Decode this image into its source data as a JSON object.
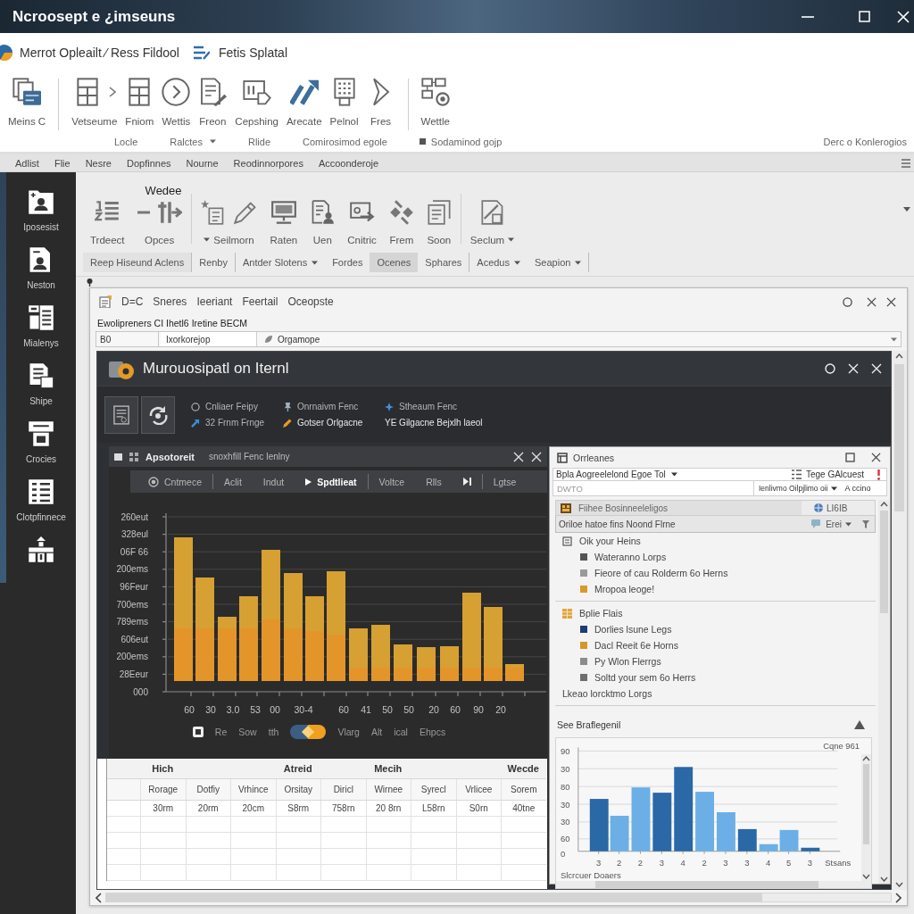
{
  "window": {
    "title": "Ncroosept e ¿imseuns"
  },
  "app_bar": {
    "breadcrumb": "Merrot Opleailt ⁄ Ress Fildool",
    "document": "Fetis Splatal"
  },
  "ribbon": {
    "sections": [
      [
        {
          "label": "Meins C"
        }
      ],
      [
        {
          "label": "Vetseume"
        },
        {
          "label": "Fniom"
        },
        {
          "label": "Wettis"
        },
        {
          "label": "Freon"
        },
        {
          "label": "Cepshing"
        },
        {
          "label": "Arecate"
        },
        {
          "label": "Pelnol"
        },
        {
          "label": "Fres"
        }
      ],
      [
        {
          "label": "Wettle"
        }
      ]
    ],
    "groups": [
      {
        "label": "Locle",
        "kind": "plain"
      },
      {
        "label": "Ralctes",
        "kind": "menu"
      },
      {
        "label": "Rlide",
        "kind": "plain"
      },
      {
        "label": "Comirosimod egole",
        "kind": "plain"
      },
      {
        "label": "Sodaminod gojp",
        "kind": "marked"
      }
    ],
    "right_label": "Derc o Konlerogios"
  },
  "menu_bar": [
    "Adlist",
    "Flie",
    "Nesre",
    "Dopfinnes",
    "Nourne",
    "Reodinnorpores",
    "Accoonderoje"
  ],
  "sidebar": {
    "items": [
      {
        "label": "Iposesist"
      },
      {
        "label": "Neston"
      },
      {
        "label": "Mialenys"
      },
      {
        "label": "Shipe"
      },
      {
        "label": "Crocies"
      },
      {
        "label": "Clotpfinnece"
      }
    ]
  },
  "ribbon_2": {
    "group_title": "Wedee",
    "sections": [
      [
        {
          "label": "Trdeect",
          "kind": "plain"
        },
        {
          "label": "Opces",
          "kind": "plain"
        }
      ],
      [
        {
          "label": "Seilmorn",
          "kind": "lead_menu"
        },
        {
          "label": "Raten",
          "kind": "plain"
        },
        {
          "label": "Uen",
          "kind": "plain"
        },
        {
          "label": "Cnitric",
          "kind": "plain"
        },
        {
          "label": "Frem",
          "kind": "plain"
        },
        {
          "label": "Soon",
          "kind": "plain"
        }
      ],
      [
        {
          "label": "Seclum",
          "kind": "menu"
        }
      ]
    ],
    "commands": [
      {
        "label": "Reep Hiseund Aclens",
        "kind": "label",
        "selected": false,
        "divider": true
      },
      {
        "label": "Renby",
        "kind": "plain",
        "selected": false,
        "divider": true
      },
      {
        "label": "Antder Slotens",
        "kind": "menu",
        "selected": false,
        "divider": false
      },
      {
        "label": "Fordes",
        "kind": "plain",
        "selected": false,
        "divider": false
      },
      {
        "label": "Ocenes",
        "kind": "plain",
        "selected": true,
        "divider": false
      },
      {
        "label": "Sphares",
        "kind": "plain",
        "selected": false,
        "divider": true
      },
      {
        "label": "Acedus",
        "kind": "menu",
        "selected": false,
        "divider": false
      },
      {
        "label": "Seapion",
        "kind": "menu",
        "selected": false,
        "divider": true
      }
    ]
  },
  "document_window": {
    "menu": [
      "D=C",
      "Sneres",
      "Ieeriant",
      "Feertail",
      "Oceopste"
    ],
    "info": "Ewolipreners CI Ihetl6 Iretine BECM",
    "fields": [
      {
        "value": "B0"
      },
      {
        "value": "Ixorkorejop"
      },
      {
        "value": "Orgamope"
      }
    ]
  },
  "dark_window": {
    "title": "Murouosipatl on Iternl",
    "options": [
      {
        "label": "Cnliaer Feipy"
      },
      {
        "label": "Onrnaivm Fenc"
      },
      {
        "label": "Stheaum Fenc"
      },
      {
        "label": "32 Frnm Frnge"
      },
      {
        "label": "Gotser Orlgacne"
      },
      {
        "label": "YE Gilgacne Bejxlh laeol"
      }
    ]
  },
  "chart_panel": {
    "title": "Apsotoreit",
    "subtitle": "snoxhfill Fenc Ienlny",
    "tabs": [
      {
        "label": "Cntmece",
        "selected": false,
        "divider": true
      },
      {
        "label": "Aclit",
        "selected": false,
        "divider": false
      },
      {
        "label": "Indut",
        "selected": false,
        "divider": false
      },
      {
        "label": "Spdtlieat",
        "selected": true,
        "divider": true
      },
      {
        "label": "Voltce",
        "selected": false,
        "divider": false
      },
      {
        "label": "Rlls",
        "selected": false,
        "divider": false
      },
      {
        "label": "Lgtse",
        "selected": false,
        "divider": false
      }
    ],
    "y_labels": [
      "260eut",
      "328eul",
      "06F 66",
      "200ems",
      "96Feur",
      "700ems",
      "789ems",
      "606eut",
      "200ems",
      "28Eeur",
      "000"
    ],
    "x_labels": [
      "60",
      "30",
      "3.0",
      "53",
      "00",
      "30-4",
      "60",
      "41",
      "50",
      "50",
      "20",
      "60",
      "90",
      "20"
    ],
    "legend": {
      "items_before": [
        "Re",
        "Sow",
        "tth"
      ],
      "toggle_on": true,
      "items_after": [
        "Vlarg",
        "Alt",
        "ical",
        "Ehpcs"
      ]
    }
  },
  "table": {
    "columns": [
      {
        "label": "Rorage",
        "group": "Hich"
      },
      {
        "label": "Dotfiy"
      },
      {
        "label": "Vrhince"
      },
      {
        "label": "Orsitay",
        "group": "Atreid"
      },
      {
        "label": "Diricl"
      },
      {
        "label": "Wirnee",
        "group": "Mecih"
      },
      {
        "label": "Syrecl"
      },
      {
        "label": "Vrlicee"
      },
      {
        "label": "Sorem",
        "group": "Wecde"
      }
    ],
    "rows": [
      [
        "30rm",
        "20rm",
        "20cm",
        "S8rm",
        "758rn",
        "20 8rn",
        "L58rn",
        "S0rn",
        "40tne"
      ]
    ]
  },
  "outline_panel": {
    "title": "Orrleanes",
    "scope": "Bpla Aogreelelond Egoe Tol",
    "action": "Tege GAlcuest",
    "search": {
      "placeholder": "DWTO"
    },
    "filter": "Ienlivmo Oilpjlimo oii",
    "filter_action": "A ccino",
    "header": "Fiihee Bosinneeleligos",
    "header_badge": "LI6IB",
    "subheader": "Oriloe hatoe fins Noond Flrne",
    "subheader_action": "Erei",
    "tree": [
      {
        "label": "Oik your Heins",
        "children": [
          {
            "label": "Wateranno Lorps",
            "color": "#555555"
          },
          {
            "label": "Fieore of cau Rolderm 6o Herns",
            "color": "#9a9a9a"
          },
          {
            "label": "Mropoa leoge!",
            "color": "#d99a2b"
          }
        ]
      },
      {
        "label": "Bplie Flais",
        "children": [
          {
            "label": "Dorlies lsune Legs",
            "color": "#1d3c78"
          },
          {
            "label": "Dacl Reeit 6e Horns",
            "color": "#d9952a"
          },
          {
            "label": "Py Wlon Flerrgs",
            "color": "#8c8c8c"
          },
          {
            "label": "Soltd your sem 6o Herrs",
            "color": "#6e6e6e"
          }
        ]
      },
      {
        "label": "Lkeao lorcktmo Lorgs"
      }
    ],
    "section": "See Braflegenil",
    "chart": {
      "legend": "Cqne 961",
      "y_labels": [
        "90",
        "30",
        "80",
        "30",
        "30",
        "60",
        "0"
      ],
      "x_labels": [
        "3",
        "2",
        "2",
        "3",
        "4",
        "2",
        "3",
        "3",
        "4",
        "5",
        "3"
      ],
      "x_end_label": "Stsans",
      "x_title": "Slcrcuer Doaers"
    }
  }
}
